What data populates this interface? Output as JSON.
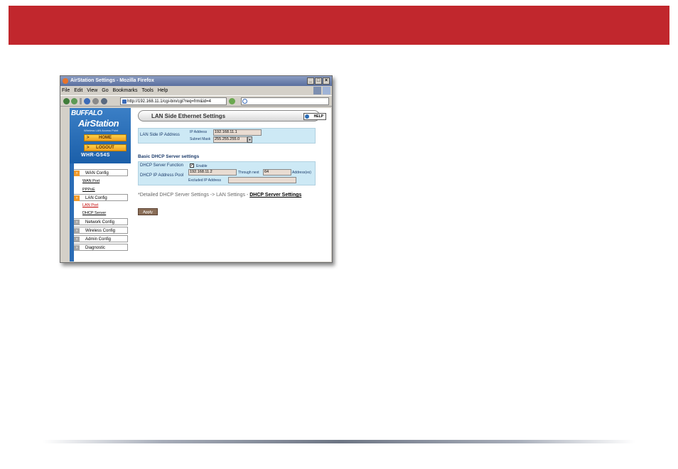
{
  "colors": {
    "banner": "#c1272d",
    "airstation_blue": "#2a6cb6",
    "menu_orange": "#f29b2c",
    "panel_bg": "#cde9f5",
    "field_bg": "#e9dcd2",
    "active_link": "#c00000"
  },
  "window": {
    "title": "AirStation Settings - Mozilla Firefox",
    "controls": {
      "minimize": "_",
      "maximize": "□",
      "close": "×"
    }
  },
  "menubar": [
    "File",
    "Edit",
    "View",
    "Go",
    "Bookmarks",
    "Tools",
    "Help"
  ],
  "toolbar": {
    "url": "http://192.168.11.1/cgi-bin/cgi?req=frm&id=4",
    "icons": [
      "back-icon",
      "forward-icon",
      "reload-icon",
      "stop-icon",
      "home-icon",
      "go-icon",
      "search-engine-icon"
    ]
  },
  "sidebar": {
    "brand": "BUFFALO",
    "product": "AirStation",
    "product_sub": "Wireless LAN Access Point",
    "home_label": "HOME",
    "logout_label": "LOGOUT",
    "model": "WHR-G54S",
    "menu": [
      {
        "label": "WAN Config",
        "expanded": true
      },
      {
        "label": "LAN Config",
        "expanded": true
      },
      {
        "label": "Network Config",
        "expanded": false
      },
      {
        "label": "Wireless Config",
        "expanded": false
      },
      {
        "label": "Admin Config",
        "expanded": false
      },
      {
        "label": "Diagnostic",
        "expanded": false
      }
    ],
    "wan_sub": [
      "WAN Port",
      "PPPoE"
    ],
    "lan_sub": [
      "LAN Port",
      "DHCP Server"
    ],
    "active_sub": "LAN Port"
  },
  "main": {
    "title": "LAN Side Ethernet Settings",
    "help_label": "HELP",
    "lan_ip": {
      "section_label": "LAN Side IP Address",
      "ip_label": "IP Address",
      "ip_value": "192.168.11.1",
      "mask_label": "Subnet Mask",
      "mask_value": "255.255.255.0"
    },
    "dhcp_heading": "Basic DHCP Server settings",
    "dhcp": {
      "function_label": "DHCP Server Function",
      "enable_label": "Enable",
      "enabled": true,
      "pool_label": "DHCP IP Address Pool",
      "pool_start": "192.168.11.2",
      "through_label": "Through next",
      "pool_count": "64",
      "address_suffix": "Address(es)",
      "excluded_label": "Excluded IP Address",
      "excluded_value": ""
    },
    "detail_text": "*Detailed DHCP Server Settings -> LAN Settings - ",
    "detail_link": "DHCP Server Settings",
    "apply_label": "Apply"
  }
}
